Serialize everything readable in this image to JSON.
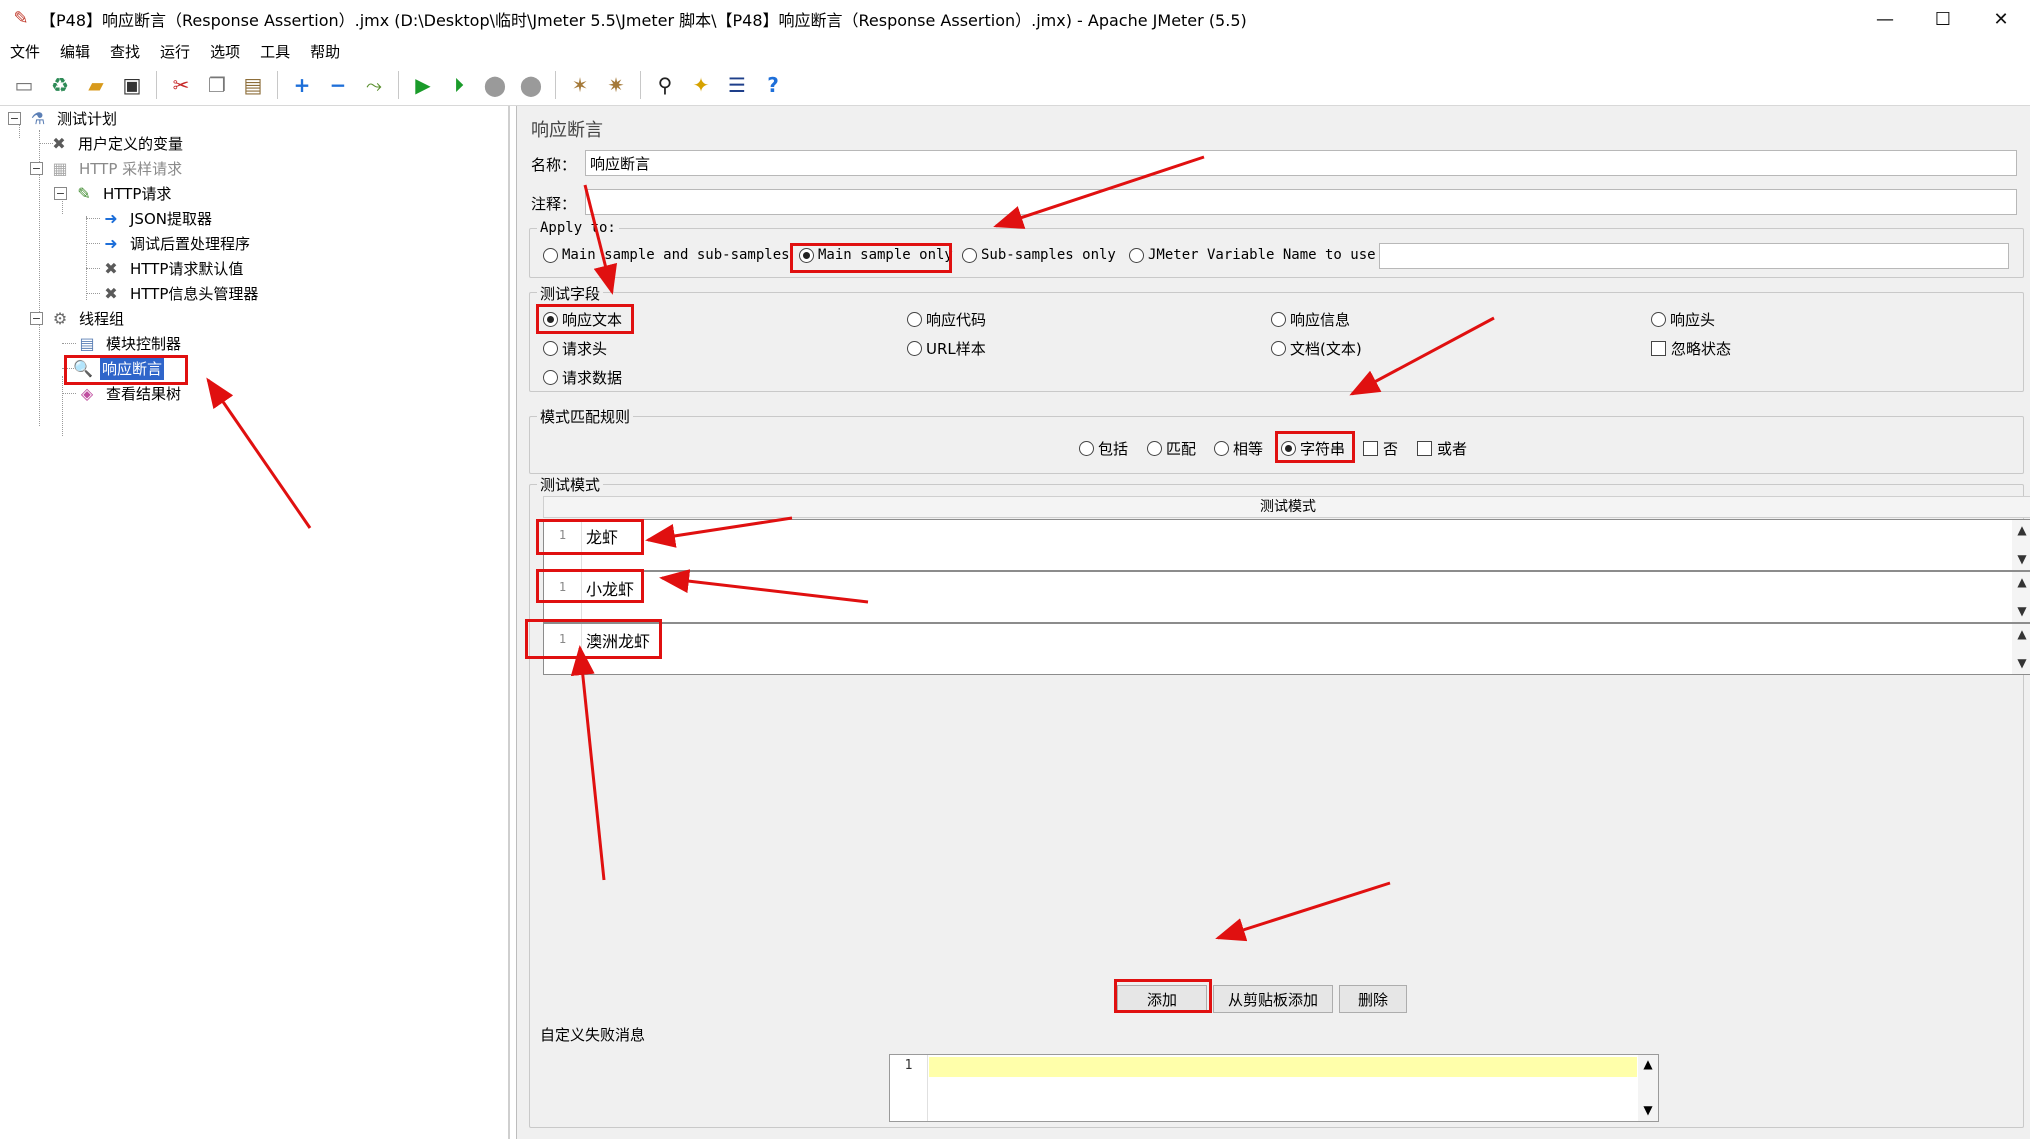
{
  "window": {
    "title": "【P48】响应断言（Response Assertion）.jmx (D:\\Desktop\\临时\\Jmeter 5.5\\Jmeter 脚本\\【P48】响应断言（Response Assertion）.jmx) - Apache JMeter (5.5)",
    "minimize": "—",
    "maximize": "☐",
    "close": "✕"
  },
  "menu": [
    "文件",
    "编辑",
    "查找",
    "运行",
    "选项",
    "工具",
    "帮助"
  ],
  "toolbar": {
    "icons": [
      "new-icon",
      "templates-icon",
      "open-icon",
      "save-icon",
      "cut-icon",
      "copy-icon",
      "paste-icon",
      "expand-icon",
      "collapse-icon",
      "toggle-icon",
      "start-icon",
      "start-no-pause-icon",
      "stop-icon",
      "shutdown-icon",
      "clear-icon",
      "clear-all-icon",
      "search-icon",
      "reset-search-icon",
      "function-helper-icon",
      "help-icon"
    ]
  },
  "tree": {
    "items": [
      {
        "label": "测试计划",
        "icon": "test-plan-icon"
      },
      {
        "label": "用户定义的变量",
        "icon": "config-element-icon"
      },
      {
        "label": "HTTP  采样请求",
        "icon": "controller-icon"
      },
      {
        "label": "HTTP请求",
        "icon": "sampler-icon"
      },
      {
        "label": "JSON提取器",
        "icon": "post-processor-icon"
      },
      {
        "label": "调试后置处理程序",
        "icon": "post-processor-icon"
      },
      {
        "label": "HTTP请求默认值",
        "icon": "config-element-icon"
      },
      {
        "label": "HTTP信息头管理器",
        "icon": "config-element-icon"
      },
      {
        "label": "线程组",
        "icon": "thread-group-icon"
      },
      {
        "label": "模块控制器",
        "icon": "module-controller-icon"
      },
      {
        "label": "响应断言",
        "icon": "assertion-icon"
      },
      {
        "label": "查看结果树",
        "icon": "listener-icon"
      }
    ]
  },
  "panel": {
    "heading": "响应断言",
    "name_label": "名称：",
    "name_value": "响应断言",
    "comment_label": "注释：",
    "comment_value": "",
    "apply_to": {
      "legend": "Apply to:",
      "options": [
        "Main sample and sub-samples",
        "Main sample only",
        "Sub-samples only",
        "JMeter Variable Name to use"
      ],
      "selected": "Main sample only",
      "variable_value": ""
    },
    "test_field": {
      "legend": "测试字段",
      "options": [
        "响应文本",
        "响应代码",
        "响应信息",
        "响应头",
        "请求头",
        "URL样本",
        "文档(文本)",
        "请求数据"
      ],
      "checkbox": "忽略状态",
      "selected": "响应文本"
    },
    "match_rules": {
      "legend": "模式匹配规则",
      "radios": [
        "包括",
        "匹配",
        "相等",
        "字符串"
      ],
      "checkboxes": [
        "否",
        "或者"
      ],
      "selected": "字符串"
    },
    "patterns": {
      "legend": "测试模式",
      "column_header": "测试模式",
      "rows": [
        {
          "line": "1",
          "text": "龙虾"
        },
        {
          "line": "1",
          "text": "小龙虾"
        },
        {
          "line": "1",
          "text": "澳洲龙虾"
        }
      ],
      "buttons": [
        "添加",
        "从剪贴板添加",
        "删除"
      ]
    },
    "failure_message": {
      "legend": "自定义失败消息",
      "line": "1",
      "value": ""
    }
  },
  "colors": {
    "annotation_red": "#e01010",
    "selection_blue": "#2f65ca",
    "current_line_yellow": "#ffffaa"
  }
}
